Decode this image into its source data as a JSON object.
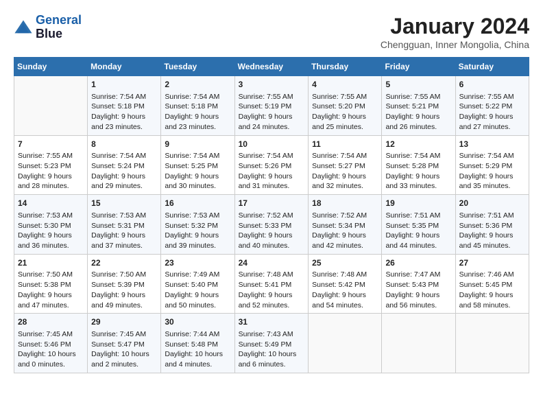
{
  "header": {
    "logo_line1": "General",
    "logo_line2": "Blue",
    "title": "January 2024",
    "subtitle": "Chengguan, Inner Mongolia, China"
  },
  "days_of_week": [
    "Sunday",
    "Monday",
    "Tuesday",
    "Wednesday",
    "Thursday",
    "Friday",
    "Saturday"
  ],
  "weeks": [
    [
      {
        "day": "",
        "info": ""
      },
      {
        "day": "1",
        "info": "Sunrise: 7:54 AM\nSunset: 5:18 PM\nDaylight: 9 hours\nand 23 minutes."
      },
      {
        "day": "2",
        "info": "Sunrise: 7:54 AM\nSunset: 5:18 PM\nDaylight: 9 hours\nand 23 minutes."
      },
      {
        "day": "3",
        "info": "Sunrise: 7:55 AM\nSunset: 5:19 PM\nDaylight: 9 hours\nand 24 minutes."
      },
      {
        "day": "4",
        "info": "Sunrise: 7:55 AM\nSunset: 5:20 PM\nDaylight: 9 hours\nand 25 minutes."
      },
      {
        "day": "5",
        "info": "Sunrise: 7:55 AM\nSunset: 5:21 PM\nDaylight: 9 hours\nand 26 minutes."
      },
      {
        "day": "6",
        "info": "Sunrise: 7:55 AM\nSunset: 5:22 PM\nDaylight: 9 hours\nand 27 minutes."
      }
    ],
    [
      {
        "day": "7",
        "info": "Sunrise: 7:55 AM\nSunset: 5:23 PM\nDaylight: 9 hours\nand 28 minutes."
      },
      {
        "day": "8",
        "info": "Sunrise: 7:54 AM\nSunset: 5:24 PM\nDaylight: 9 hours\nand 29 minutes."
      },
      {
        "day": "9",
        "info": "Sunrise: 7:54 AM\nSunset: 5:25 PM\nDaylight: 9 hours\nand 30 minutes."
      },
      {
        "day": "10",
        "info": "Sunrise: 7:54 AM\nSunset: 5:26 PM\nDaylight: 9 hours\nand 31 minutes."
      },
      {
        "day": "11",
        "info": "Sunrise: 7:54 AM\nSunset: 5:27 PM\nDaylight: 9 hours\nand 32 minutes."
      },
      {
        "day": "12",
        "info": "Sunrise: 7:54 AM\nSunset: 5:28 PM\nDaylight: 9 hours\nand 33 minutes."
      },
      {
        "day": "13",
        "info": "Sunrise: 7:54 AM\nSunset: 5:29 PM\nDaylight: 9 hours\nand 35 minutes."
      }
    ],
    [
      {
        "day": "14",
        "info": "Sunrise: 7:53 AM\nSunset: 5:30 PM\nDaylight: 9 hours\nand 36 minutes."
      },
      {
        "day": "15",
        "info": "Sunrise: 7:53 AM\nSunset: 5:31 PM\nDaylight: 9 hours\nand 37 minutes."
      },
      {
        "day": "16",
        "info": "Sunrise: 7:53 AM\nSunset: 5:32 PM\nDaylight: 9 hours\nand 39 minutes."
      },
      {
        "day": "17",
        "info": "Sunrise: 7:52 AM\nSunset: 5:33 PM\nDaylight: 9 hours\nand 40 minutes."
      },
      {
        "day": "18",
        "info": "Sunrise: 7:52 AM\nSunset: 5:34 PM\nDaylight: 9 hours\nand 42 minutes."
      },
      {
        "day": "19",
        "info": "Sunrise: 7:51 AM\nSunset: 5:35 PM\nDaylight: 9 hours\nand 44 minutes."
      },
      {
        "day": "20",
        "info": "Sunrise: 7:51 AM\nSunset: 5:36 PM\nDaylight: 9 hours\nand 45 minutes."
      }
    ],
    [
      {
        "day": "21",
        "info": "Sunrise: 7:50 AM\nSunset: 5:38 PM\nDaylight: 9 hours\nand 47 minutes."
      },
      {
        "day": "22",
        "info": "Sunrise: 7:50 AM\nSunset: 5:39 PM\nDaylight: 9 hours\nand 49 minutes."
      },
      {
        "day": "23",
        "info": "Sunrise: 7:49 AM\nSunset: 5:40 PM\nDaylight: 9 hours\nand 50 minutes."
      },
      {
        "day": "24",
        "info": "Sunrise: 7:48 AM\nSunset: 5:41 PM\nDaylight: 9 hours\nand 52 minutes."
      },
      {
        "day": "25",
        "info": "Sunrise: 7:48 AM\nSunset: 5:42 PM\nDaylight: 9 hours\nand 54 minutes."
      },
      {
        "day": "26",
        "info": "Sunrise: 7:47 AM\nSunset: 5:43 PM\nDaylight: 9 hours\nand 56 minutes."
      },
      {
        "day": "27",
        "info": "Sunrise: 7:46 AM\nSunset: 5:45 PM\nDaylight: 9 hours\nand 58 minutes."
      }
    ],
    [
      {
        "day": "28",
        "info": "Sunrise: 7:45 AM\nSunset: 5:46 PM\nDaylight: 10 hours\nand 0 minutes."
      },
      {
        "day": "29",
        "info": "Sunrise: 7:45 AM\nSunset: 5:47 PM\nDaylight: 10 hours\nand 2 minutes."
      },
      {
        "day": "30",
        "info": "Sunrise: 7:44 AM\nSunset: 5:48 PM\nDaylight: 10 hours\nand 4 minutes."
      },
      {
        "day": "31",
        "info": "Sunrise: 7:43 AM\nSunset: 5:49 PM\nDaylight: 10 hours\nand 6 minutes."
      },
      {
        "day": "",
        "info": ""
      },
      {
        "day": "",
        "info": ""
      },
      {
        "day": "",
        "info": ""
      }
    ]
  ]
}
